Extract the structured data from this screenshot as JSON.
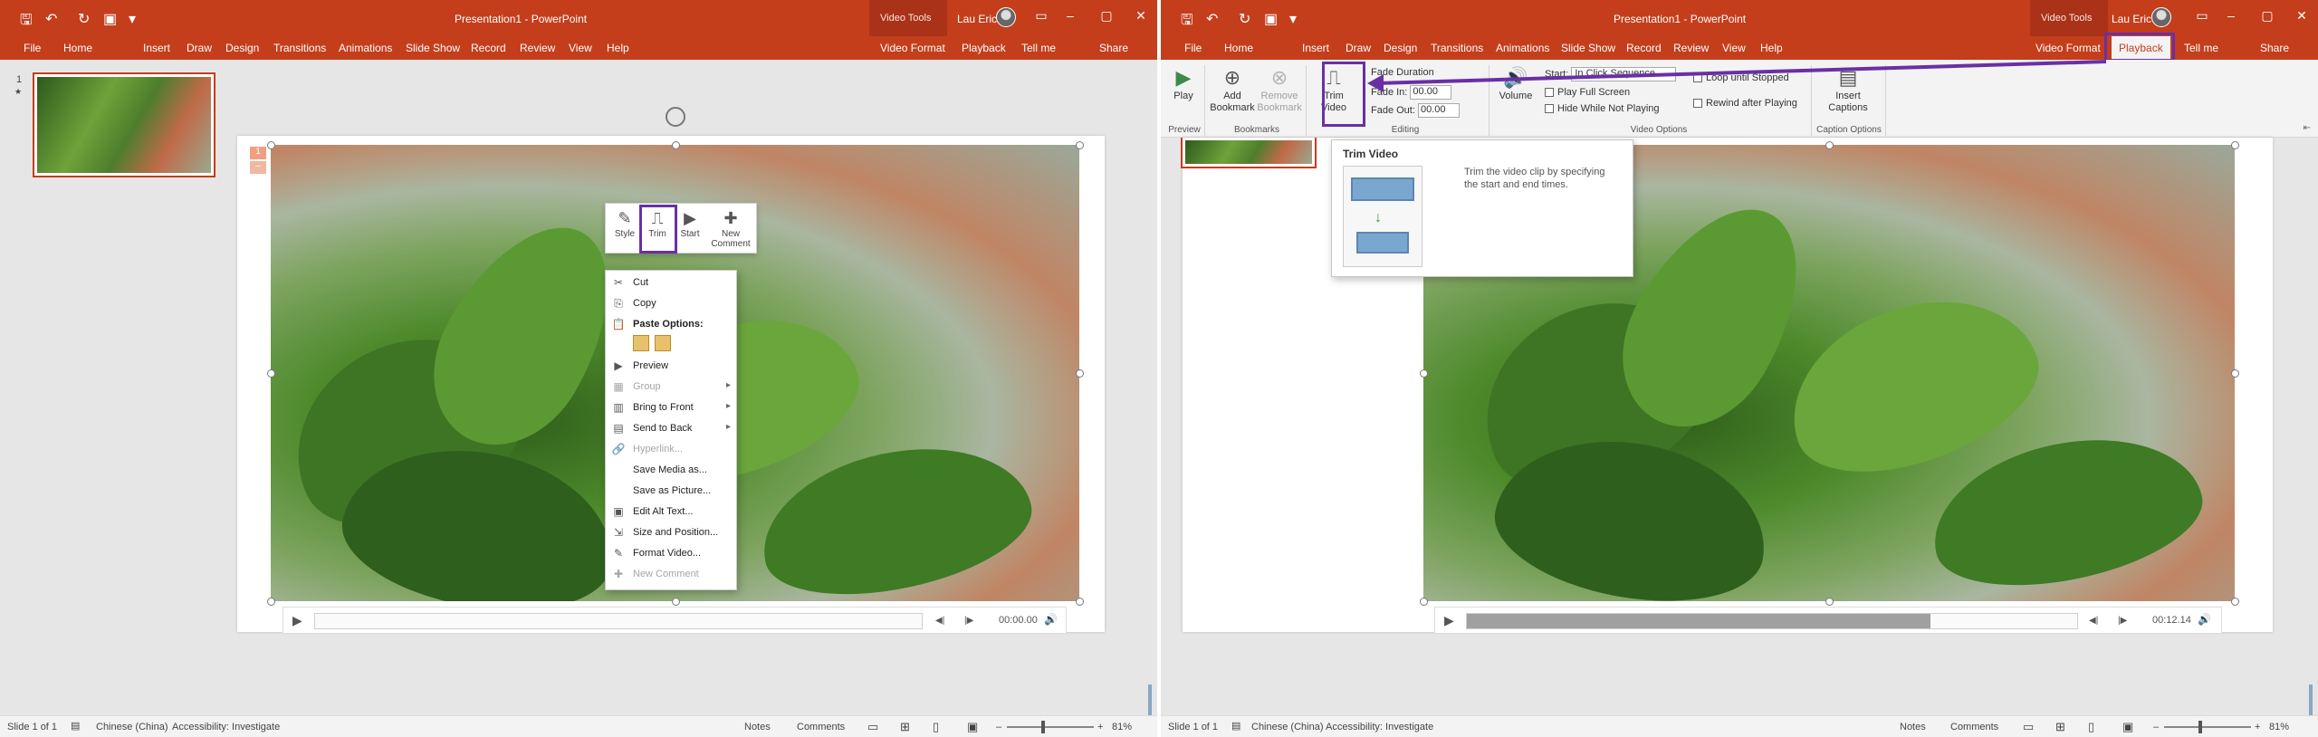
{
  "left": {
    "qat": {
      "save": "🖫",
      "undo": "↶",
      "redo": "↻",
      "present": "▣",
      "more": "▾"
    },
    "title": "Presentation1 - PowerPoint",
    "context_group": "Video Tools",
    "user": "Lau Eric",
    "window_buttons": [
      "▭",
      "–",
      "▢",
      "✕"
    ],
    "tabs": [
      "File",
      "Home",
      "Insert",
      "Draw",
      "Design",
      "Transitions",
      "Animations",
      "Slide Show",
      "Record",
      "Review",
      "View",
      "Help",
      "Video Format",
      "Playback",
      "Tell me",
      "Share"
    ],
    "slide_number": "1",
    "slide_star": "★",
    "slide_badge": [
      "1",
      "–"
    ],
    "minibar": [
      {
        "icon": "✎",
        "label": "Style"
      },
      {
        "icon": "⎍",
        "label": "Trim"
      },
      {
        "icon": "▶",
        "label": "Start"
      },
      {
        "icon": "✚",
        "label": "New Comment"
      }
    ],
    "context_menu": [
      {
        "icon": "✂",
        "label": "Cut",
        "disabled": false,
        "arrow": ""
      },
      {
        "icon": "⎘",
        "label": "Copy",
        "disabled": false,
        "arrow": ""
      },
      {
        "icon": "📋",
        "label": "Paste Options:",
        "disabled": false,
        "arrow": "",
        "bold": true
      },
      {
        "icon": "",
        "label": "",
        "disabled": false,
        "arrow": "",
        "paste": true
      },
      {
        "icon": "▶",
        "label": "Preview",
        "disabled": false,
        "arrow": ""
      },
      {
        "icon": "▦",
        "label": "Group",
        "disabled": true,
        "arrow": "▸"
      },
      {
        "icon": "▥",
        "label": "Bring to Front",
        "disabled": false,
        "arrow": "▸"
      },
      {
        "icon": "▤",
        "label": "Send to Back",
        "disabled": false,
        "arrow": "▸"
      },
      {
        "icon": "🔗",
        "label": "Hyperlink...",
        "disabled": true,
        "arrow": ""
      },
      {
        "icon": "",
        "label": "Save Media as...",
        "disabled": false,
        "arrow": ""
      },
      {
        "icon": "",
        "label": "Save as Picture...",
        "disabled": false,
        "arrow": ""
      },
      {
        "icon": "▣",
        "label": "Edit Alt Text...",
        "disabled": false,
        "arrow": ""
      },
      {
        "icon": "⇲",
        "label": "Size and Position...",
        "disabled": false,
        "arrow": ""
      },
      {
        "icon": "✎",
        "label": "Format Video...",
        "disabled": false,
        "arrow": ""
      },
      {
        "icon": "✚",
        "label": "New Comment",
        "disabled": true,
        "arrow": ""
      }
    ],
    "video_controls": {
      "play": "▶",
      "back": "◀|",
      "forward": "|▶",
      "time": "00:00.00",
      "volume": "🔊"
    },
    "progress": 0,
    "status": {
      "slide": "Slide 1 of 1",
      "language": "Chinese (China)",
      "accessibility": "Accessibility: Investigate",
      "notes": "Notes",
      "comments": "Comments",
      "zoom": "81%"
    }
  },
  "right": {
    "title": "Presentation1 - PowerPoint",
    "context_group": "Video Tools",
    "user": "Lau Eric",
    "tabs": [
      "File",
      "Home",
      "Insert",
      "Draw",
      "Design",
      "Transitions",
      "Animations",
      "Slide Show",
      "Record",
      "Review",
      "View",
      "Help",
      "Video Format",
      "Playback",
      "Tell me",
      "Share"
    ],
    "ribbon": {
      "play": "Play",
      "add_bookmark": "Add Bookmark",
      "remove_bookmark": "Remove Bookmark",
      "trim_video": "Trim Video",
      "fade_duration": "Fade Duration",
      "fade_in_label": "Fade In:",
      "fade_in_value": "00.00",
      "fade_out_label": "Fade Out:",
      "fade_out_value": "00.00",
      "volume": "Volume",
      "start_label": "Start:",
      "start_value": "In Click Sequence",
      "play_full_screen": "Play Full Screen",
      "hide_while_not_playing": "Hide While Not Playing",
      "loop_until_stopped": "Loop until Stopped",
      "rewind_after_playing": "Rewind after Playing",
      "insert_captions": "Insert Captions",
      "groups": [
        "Preview",
        "Bookmarks",
        "Editing",
        "Video Options",
        "Caption Options"
      ]
    },
    "tooltip": {
      "title": "Trim Video",
      "description": "Trim the video clip by specifying the start and end times."
    },
    "video_controls": {
      "play": "▶",
      "back": "◀|",
      "forward": "|▶",
      "time": "00:12.14",
      "volume": "🔊"
    },
    "progress": 0.76,
    "status": {
      "slide": "Slide 1 of 1",
      "language": "Chinese (China)",
      "accessibility": "Accessibility: Investigate",
      "notes": "Notes",
      "comments": "Comments",
      "zoom": "81%"
    }
  },
  "colors": {
    "accent": "#c43e1c",
    "highlight": "#6a2fa5"
  }
}
